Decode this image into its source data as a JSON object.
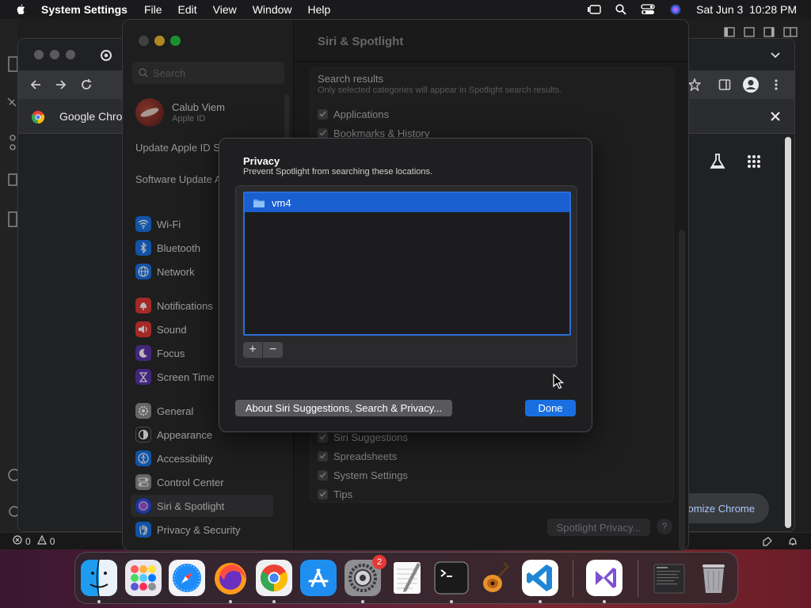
{
  "menubar": {
    "app_name": "System Settings",
    "menus": [
      "File",
      "Edit",
      "View",
      "Window",
      "Help"
    ],
    "datetime": "Sat Jun 3  10:28 PM"
  },
  "chrome": {
    "tab_label": "Google Chrome",
    "customize_label": "Customize Chrome"
  },
  "vscode": {
    "errors": "0",
    "warnings": "0"
  },
  "settings": {
    "search_placeholder": "Search",
    "profile": {
      "name": "Calub Viem",
      "subtitle": "Apple ID"
    },
    "notices": [
      "Update Apple ID Settings",
      "Software Update Available"
    ],
    "sidebar_items": [
      {
        "label": "Wi-Fi",
        "color": "#1a73e8"
      },
      {
        "label": "Bluetooth",
        "color": "#1a73e8"
      },
      {
        "label": "Network",
        "color": "#1a73e8"
      },
      {
        "label": "Notifications",
        "color": "#e53935"
      },
      {
        "label": "Sound",
        "color": "#e53935"
      },
      {
        "label": "Focus",
        "color": "#5e35b1"
      },
      {
        "label": "Screen Time",
        "color": "#5e35b1"
      },
      {
        "label": "General",
        "color": "#8e8e93"
      },
      {
        "label": "Appearance",
        "color": "#2b2b2b"
      },
      {
        "label": "Accessibility",
        "color": "#1a73e8"
      },
      {
        "label": "Control Center",
        "color": "#8e8e93"
      },
      {
        "label": "Siri & Spotlight",
        "color": "#6a3fb5"
      },
      {
        "label": "Privacy & Security",
        "color": "#1a73e8"
      }
    ],
    "active_item": "Siri & Spotlight",
    "content_title": "Siri & Spotlight",
    "search_results_title": "Search results",
    "search_results_subtitle": "Only selected categories will appear in Spotlight search results.",
    "categories_top": [
      "Applications",
      "Bookmarks & History"
    ],
    "categories_bottom": [
      "Siri Suggestions",
      "Spreadsheets",
      "System Settings",
      "Tips"
    ],
    "spotlight_privacy_button": "Spotlight Privacy...",
    "help_label": "?"
  },
  "privacy_sheet": {
    "title": "Privacy",
    "subtitle": "Prevent Spotlight from searching these locations.",
    "locations": [
      "vm4"
    ],
    "add_label": "+",
    "remove_label": "−",
    "about_button": "About Siri Suggestions, Search & Privacy...",
    "done_button": "Done",
    "accent": "#1a6fe0"
  },
  "dock": {
    "apps": [
      "Finder",
      "Launchpad",
      "Safari",
      "Firefox",
      "Google Chrome",
      "App Store",
      "System Settings",
      "TextEdit",
      "Terminal",
      "GarageBand",
      "Visual Studio Code",
      "Visual Studio",
      "Window Preview",
      "Trash"
    ],
    "settings_badge": "2"
  }
}
